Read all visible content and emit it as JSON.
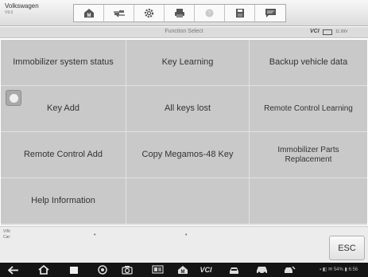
{
  "vehicle": {
    "make": "Volkswagen",
    "version": "V9.0"
  },
  "toolbar": {
    "icons": [
      "home-icon",
      "vehicle-swap-icon",
      "settings-icon",
      "print-icon",
      "help-icon",
      "save-icon",
      "message-icon"
    ]
  },
  "titlebar": {
    "title": "Function Select",
    "vci_label": "VCI",
    "voltage": "11.99V"
  },
  "functions": [
    "Immobilizer system status",
    "Key Learning",
    "Backup vehicle data",
    "Key Add",
    "All keys lost",
    "Remote Control Learning",
    "Remote Control Add",
    "Copy Megamos-48 Key",
    "Immobilizer Parts Replacement",
    "Help Information",
    "",
    ""
  ],
  "info": {
    "vin_label": "VIN:",
    "car_label": "Car:",
    "vin_dot": "•",
    "car_dot": "•"
  },
  "esc_label": "ESC",
  "navbar": {
    "icons": [
      "back-icon",
      "home-icon",
      "recent-apps-icon",
      "browser-icon",
      "camera-icon",
      "screen-mirror-icon",
      "maxisys-home-icon",
      "vci-icon",
      "car-menu-icon",
      "car-icon",
      "vehicle-service-icon"
    ],
    "vci_text": "VCI",
    "status_text": "▪ ◧ ✉ 54% ▮ 6:56"
  },
  "colors": {
    "cell_bg": "#c9c9c9",
    "grid_gap": "#e2e2e2",
    "navbar_bg": "#141414"
  }
}
